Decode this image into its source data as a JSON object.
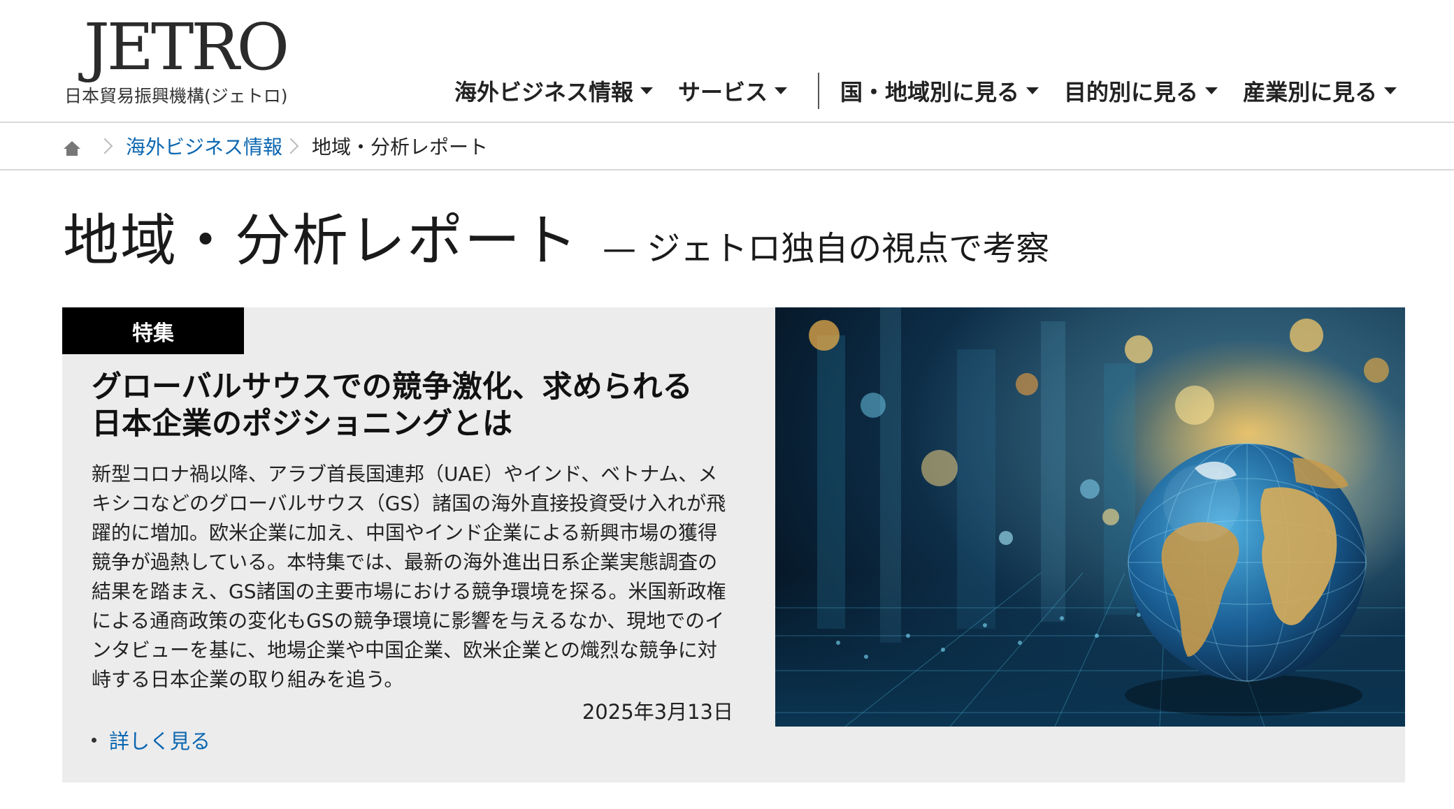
{
  "header": {
    "logo_text": "JETRO",
    "logo_subtitle": "日本貿易振興機構(ジェトロ)",
    "nav": [
      {
        "label": "海外ビジネス情報"
      },
      {
        "label": "サービス"
      },
      {
        "label": "国・地域別に見る"
      },
      {
        "label": "目的別に見る"
      },
      {
        "label": "産業別に見る"
      }
    ]
  },
  "breadcrumb": {
    "home_icon": "home-icon",
    "link": "海外ビジネス情報",
    "current": "地域・分析レポート"
  },
  "page": {
    "title": "地域・分析レポート",
    "subtitle": "— ジェトロ独自の視点で考察"
  },
  "feature": {
    "badge": "特集",
    "title_line1": "グローバルサウスでの競争激化、求められる",
    "title_line2": "日本企業のポジショニングとは",
    "body_lines": [
      "新型コロナ禍以降、アラブ首長国連邦（UAE）やインド、ベトナム、メ",
      "キシコなどのグローバルサウス（GS）諸国の海外直接投資受け入れが飛",
      "躍的に増加。欧米企業に加え、中国やインド企業による新興市場の獲得",
      "競争が過熱している。本特集では、最新の海外進出日系企業実態調査の",
      "結果を踏まえ、GS諸国の主要市場における競争環境を探る。米国新政権",
      "による通商政策の変化もGSの競争環境に影響を与えるなか、現地でのイ",
      "ンタビューを基に、地場企業や中国企業、欧米企業との熾烈な競争に対",
      "峙する日本企業の取り組みを追う。"
    ],
    "date": "2025年3月13日",
    "more_link": "詳しく見る",
    "image": "globe-digital-network-image"
  }
}
